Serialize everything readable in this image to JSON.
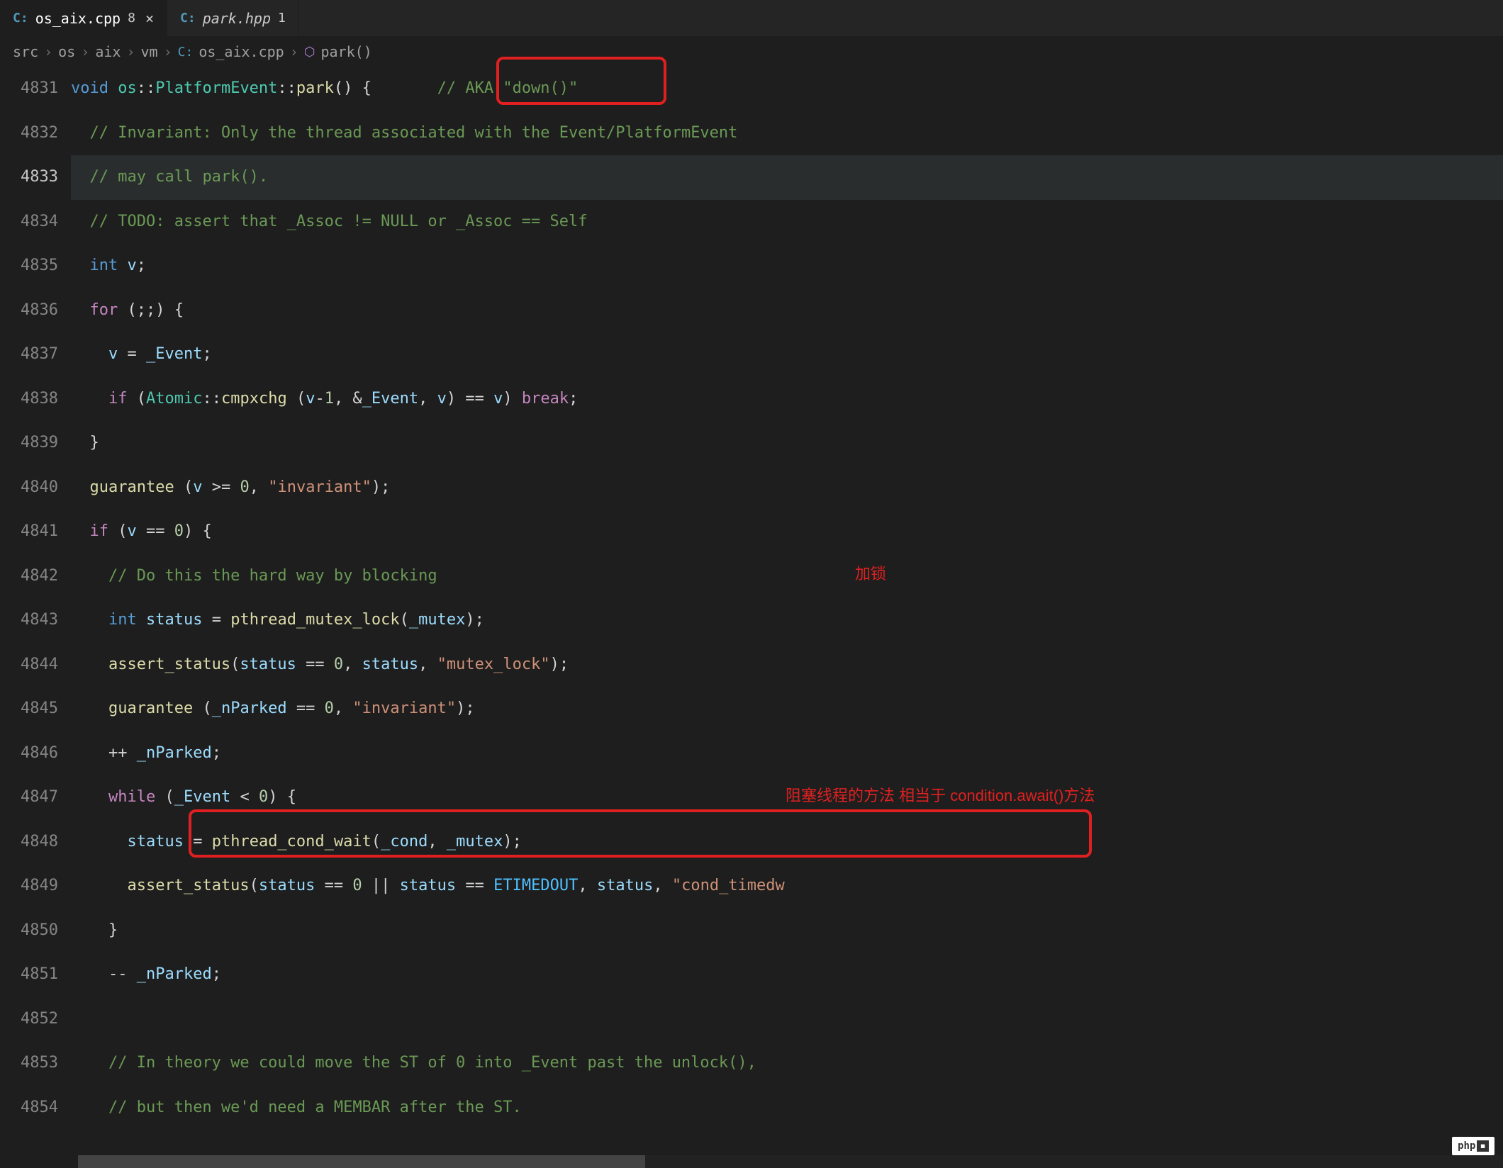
{
  "tabs": [
    {
      "icon": "C:",
      "name": "os_aix.cpp",
      "badge": "8",
      "close": "×",
      "active": true
    },
    {
      "icon": "C:",
      "name": "park.hpp",
      "badge": "1",
      "close": "",
      "active": false
    }
  ],
  "breadcrumbs": {
    "items": [
      "src",
      "os",
      "aix",
      "vm"
    ],
    "file_icon": "C:",
    "file": "os_aix.cpp",
    "symbol_icon": "⬡",
    "symbol": "park()",
    "sep": "›"
  },
  "lines": [
    {
      "num": "4831",
      "active": false
    },
    {
      "num": "4832",
      "active": false
    },
    {
      "num": "4833",
      "active": true
    },
    {
      "num": "4834",
      "active": false
    },
    {
      "num": "4835",
      "active": false
    },
    {
      "num": "4836",
      "active": false
    },
    {
      "num": "4837",
      "active": false
    },
    {
      "num": "4838",
      "active": false
    },
    {
      "num": "4839",
      "active": false
    },
    {
      "num": "4840",
      "active": false
    },
    {
      "num": "4841",
      "active": false
    },
    {
      "num": "4842",
      "active": false
    },
    {
      "num": "4843",
      "active": false
    },
    {
      "num": "4844",
      "active": false
    },
    {
      "num": "4845",
      "active": false
    },
    {
      "num": "4846",
      "active": false
    },
    {
      "num": "4847",
      "active": false
    },
    {
      "num": "4848",
      "active": false
    },
    {
      "num": "4849",
      "active": false
    },
    {
      "num": "4850",
      "active": false
    },
    {
      "num": "4851",
      "active": false
    },
    {
      "num": "4852",
      "active": false
    },
    {
      "num": "4853",
      "active": false
    },
    {
      "num": "4854",
      "active": false
    }
  ],
  "code": {
    "l4831": {
      "kw": "void",
      "ns": "os",
      "cls": "PlatformEvent",
      "fn": "park",
      "cmt": "// AKA \"down()\""
    },
    "l4832": {
      "cmt": "// Invariant: Only the thread associated with the Event/PlatformEvent"
    },
    "l4833": {
      "cmt": "// may call park()."
    },
    "l4834": {
      "cmt": "// TODO: assert that _Assoc != NULL or _Assoc == Self"
    },
    "l4835": {
      "type": "int",
      "var": "v"
    },
    "l4836": {
      "kw": "for"
    },
    "l4837": {
      "var": "v",
      "rhs": "_Event"
    },
    "l4838": {
      "kw": "if",
      "cls": "Atomic",
      "fn": "cmpxchg",
      "v": "v",
      "ev": "_Event",
      "brk": "break"
    },
    "l4840": {
      "fn": "guarantee",
      "v": "v",
      "str": "\"invariant\""
    },
    "l4841": {
      "kw": "if",
      "v": "v"
    },
    "l4842": {
      "cmt": "// Do this the hard way by blocking"
    },
    "l4843": {
      "type": "int",
      "var": "status",
      "fn": "pthread_mutex_lock",
      "arg": "_mutex"
    },
    "l4844": {
      "fn": "assert_status",
      "var": "status",
      "str": "\"mutex_lock\""
    },
    "l4845": {
      "fn": "guarantee",
      "var": "_nParked",
      "str": "\"invariant\""
    },
    "l4846": {
      "var": "_nParked"
    },
    "l4847": {
      "kw": "while",
      "var": "_Event"
    },
    "l4848": {
      "var": "status",
      "fn": "pthread_cond_wait",
      "a1": "_cond",
      "a2": "_mutex"
    },
    "l4849": {
      "fn": "assert_status",
      "var": "status",
      "c": "ETIMEDOUT",
      "str": "\"cond_timedw"
    },
    "l4851": {
      "var": "_nParked"
    },
    "l4853": {
      "cmt": "// In theory we could move the ST of 0 into _Event past the unlock(),"
    },
    "l4854": {
      "cmt": "// but then we'd need a MEMBAR after the ST."
    }
  },
  "annotations": {
    "a1": "加锁",
    "a2": "阻塞线程的方法 相当于 condition.await()方法"
  },
  "logo": "php"
}
